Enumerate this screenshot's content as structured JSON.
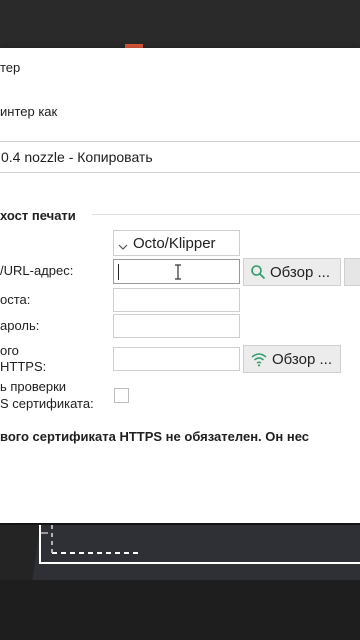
{
  "dialog": {
    "title_fragment": "тер",
    "printer_as_label": "интер как",
    "preset_name": "0.4 nozzle - Копировать",
    "section_heading": "хост печати",
    "host_type_value": "Octo/Klipper",
    "url_label": "/URL-адрес:",
    "url_value": "",
    "browse_label": "Обзор ...",
    "login_label": "оста:",
    "password_label": "ароль:",
    "cert_label_line1": "ого",
    "cert_label_line2": "HTTPS:",
    "cert_browse_label": "Обзор ...",
    "ignore_checks_line1": "ь проверки",
    "ignore_checks_line2": "S сертификата:",
    "ignore_checks_checked": false,
    "footnote": "вого сертификата HTTPS не обязателен. Он нес"
  },
  "icons": {
    "chevron": "chevron-down-icon",
    "search": "search-icon",
    "wifi": "wifi-icon",
    "cursor": "text-cursor-icon"
  },
  "colors": {
    "accent": "#d9583b",
    "icon_green": "#2e9e6b",
    "viewport_border": "#ffffff"
  }
}
